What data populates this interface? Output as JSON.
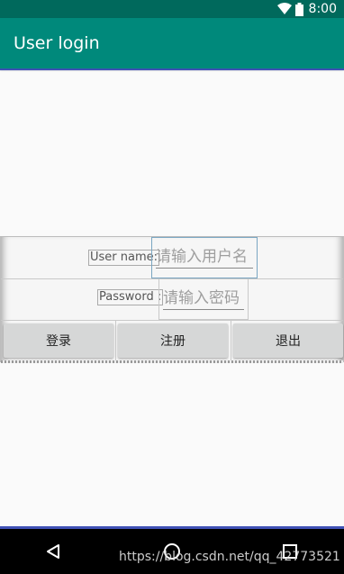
{
  "status_bar": {
    "time": "8:00"
  },
  "app_bar": {
    "title": "User login"
  },
  "form": {
    "username_label": "User name:",
    "username_placeholder": "请输入用户名",
    "password_label": "Password :",
    "password_placeholder": "请输入密码"
  },
  "buttons": {
    "login": "登录",
    "register": "注册",
    "exit": "退出"
  },
  "watermark": "https://blog.csdn.net/qq_42773521",
  "colors": {
    "status_bar": "#00695c",
    "app_bar": "#00897b",
    "nav_bar": "#000000"
  }
}
